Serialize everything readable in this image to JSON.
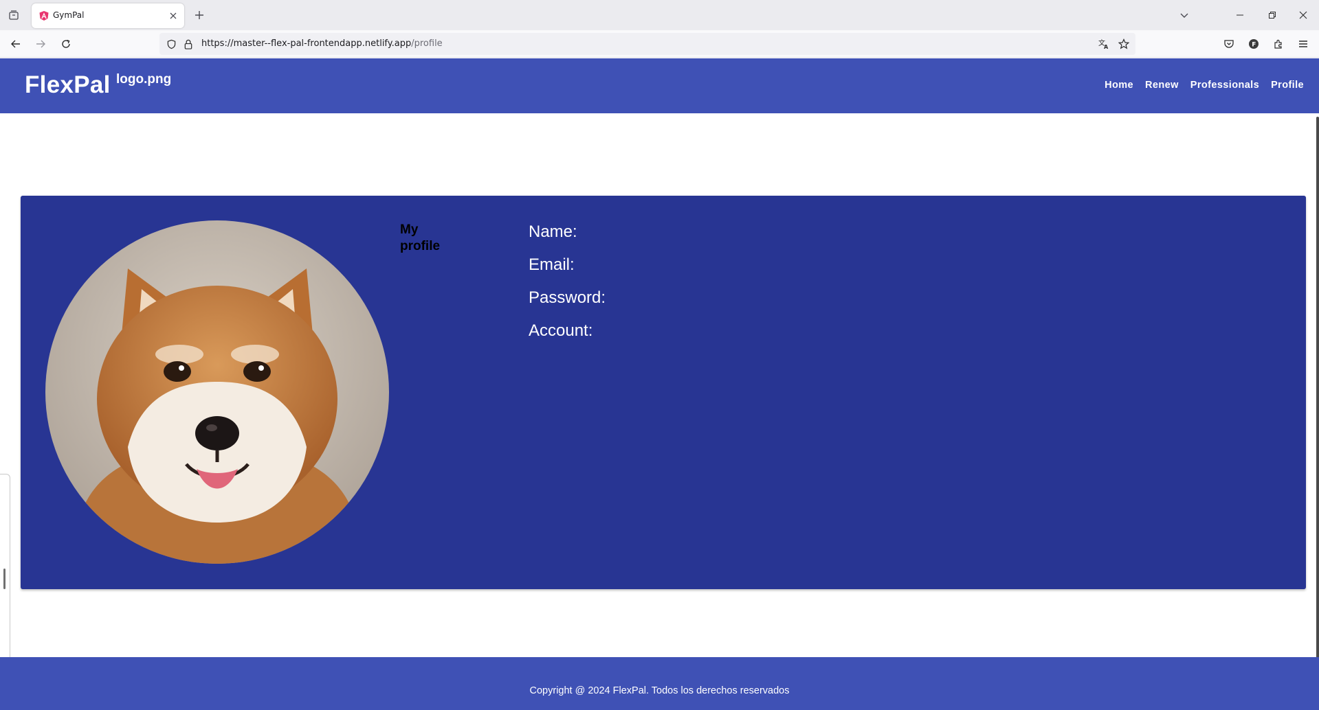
{
  "browser": {
    "tab": {
      "title": "GymPal"
    },
    "url": {
      "base": "https://master--flex-pal-frontendapp.netlify.app",
      "path": "/profile"
    },
    "icons": [
      "tab-list-icon",
      "angular-favicon",
      "close-icon",
      "plus-icon",
      "chevron-down-icon",
      "minimize-icon",
      "restore-icon",
      "close-window-icon",
      "back-arrow-icon",
      "forward-arrow-icon",
      "reload-icon",
      "shield-icon",
      "lock-icon",
      "translate-icon",
      "star-icon",
      "pocket-icon",
      "account-icon",
      "extensions-icon",
      "menu-icon"
    ]
  },
  "site": {
    "brand": "FlexPal",
    "logo_alt": "logo.png",
    "nav": [
      {
        "label": "Home"
      },
      {
        "label": "Renew"
      },
      {
        "label": "Professionals"
      },
      {
        "label": "Profile"
      }
    ]
  },
  "profile": {
    "title": "My profile",
    "fields": [
      {
        "label": "Name:"
      },
      {
        "label": "Email:"
      },
      {
        "label": "Password:"
      },
      {
        "label": "Account:"
      }
    ]
  },
  "footer": {
    "copyright": "Copyright @ 2024 FlexPal. Todos los derechos reservados"
  },
  "colors": {
    "header": "#3f51b5",
    "card": "#283593",
    "footer": "#3f51b5"
  }
}
